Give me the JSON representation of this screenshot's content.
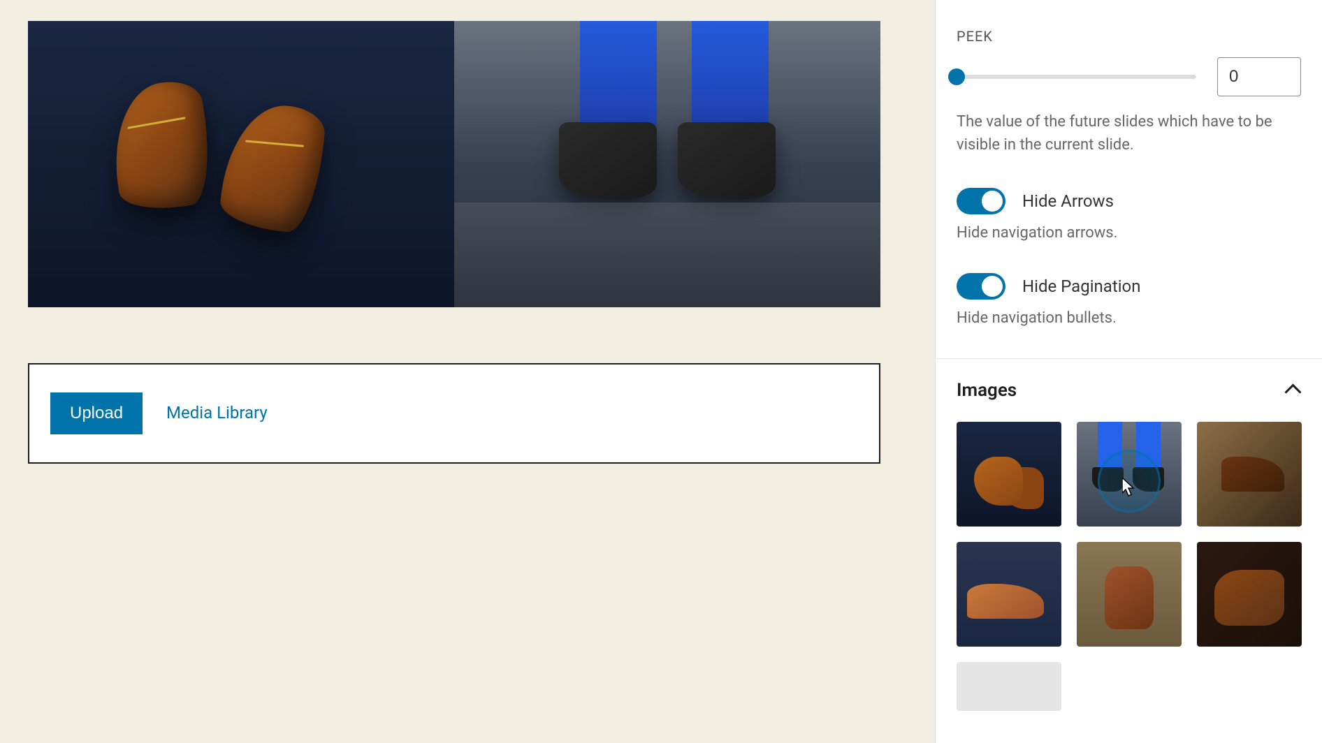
{
  "upload": {
    "upload_button": "Upload",
    "media_library_link": "Media Library"
  },
  "sidebar": {
    "peek": {
      "label": "PEEK",
      "value": "0",
      "help": "The value of the future slides which have to be visible in the current slide."
    },
    "hide_arrows": {
      "label": "Hide Arrows",
      "enabled": true,
      "help": "Hide navigation arrows."
    },
    "hide_pagination": {
      "label": "Hide Pagination",
      "enabled": true,
      "help": "Hide navigation bullets."
    },
    "images": {
      "title": "Images",
      "expanded": true,
      "count": 6
    }
  }
}
